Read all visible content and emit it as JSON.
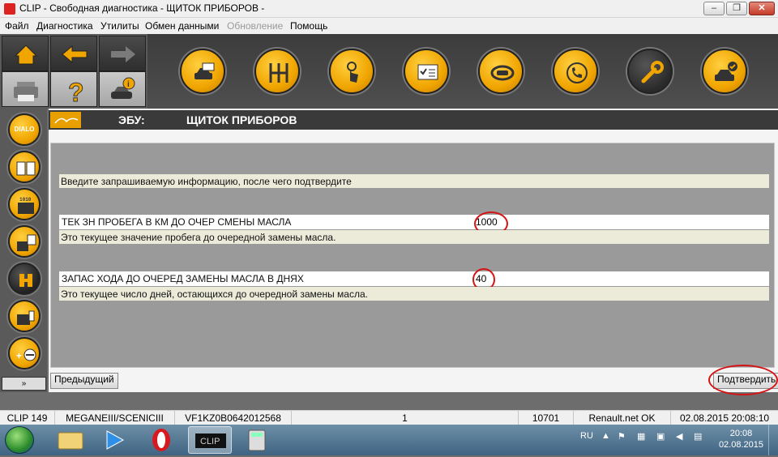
{
  "window": {
    "title": "CLIP - Свободная диагностика - ЩИТОК ПРИБОРОВ -",
    "min_label": "–",
    "restore_label": "❐",
    "close_label": "✕"
  },
  "menu": {
    "items": [
      "Файл",
      "Диагностика",
      "Утилиты",
      "Обмен данными",
      "Обновление",
      "Помощь"
    ]
  },
  "toolbar": {
    "left_tiles": [
      "home-icon",
      "arrow-left-icon",
      "arrow-right-icon",
      "printer-icon",
      "help-icon",
      "car-info-icon"
    ],
    "ribbon_buttons": [
      "vehicle-id-icon",
      "gearbox-icon",
      "touch-icon",
      "checklist-icon",
      "diagnostic-car-icon",
      "phone-support-icon",
      "wrench-icon",
      "car-check-icon"
    ]
  },
  "sidebar": {
    "buttons": [
      "DIALO",
      "book-icon",
      "ecu-data-icon",
      "ecu-checklist-icon",
      "ecu-selected-icon",
      "ecu-program-icon",
      "plus-minus-icon"
    ],
    "dialo_label": "DIALO",
    "scroll_label": "»"
  },
  "header": {
    "ecu_label": "ЭБУ:",
    "ecu_name": "ЩИТОК ПРИБОРОВ"
  },
  "form": {
    "instruction": "Введите запрашиваемую информацию, после чего подтвердите",
    "param1_label": "ТЕК ЗН ПРОБЕГА В КМ ДО ОЧЕР СМЕНЫ МАСЛА",
    "param1_value": "1000",
    "param1_desc": "Это текущее значение пробега до очередной замены масла.",
    "param2_label": "ЗАПАС ХОДА ДО ОЧЕРЕД ЗАМЕНЫ МАСЛА В ДНЯХ",
    "param2_value": "40",
    "param2_desc": "Это текущее число дней, остающихся до очередной замены масла."
  },
  "nav": {
    "prev_label": "Предыдущий",
    "confirm_label": "Подтвердить"
  },
  "statusbar": {
    "clip": "CLIP 149",
    "vehicle": "MEGANEIII/SCENICIII",
    "vin": "VF1KZ0B0642012568",
    "count": "1",
    "code": "10701",
    "network": "Renault.net OK",
    "datetime": "02.08.2015 20:08:10"
  },
  "taskbar": {
    "lang": "RU",
    "time": "20:08",
    "date": "02.08.2015",
    "clip_task": "CLIP"
  },
  "colors": {
    "accent": "#f0a500",
    "annotation": "#d41414",
    "panel": "#9a9a9a"
  }
}
